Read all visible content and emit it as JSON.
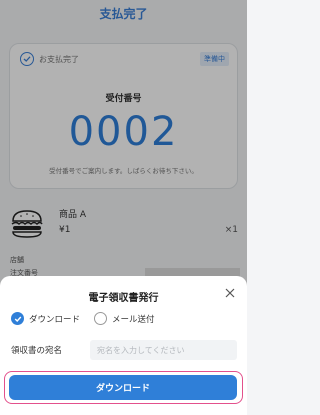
{
  "header": {
    "title": "支払完了"
  },
  "order_card": {
    "status": "お支払完了",
    "badge": "準備中",
    "reception_label": "受付番号",
    "reception_number": "0002",
    "reception_note": "受付番号でご案内します。しばらくお待ち下さい。"
  },
  "item": {
    "name": "商品 A",
    "price": "¥1",
    "quantity": "×1"
  },
  "details": {
    "store_label": "店舗",
    "order_no_label": "注文番号"
  },
  "receipt_sheet": {
    "title": "電子領収書発行",
    "options": [
      {
        "label": "ダウンロード",
        "selected": true
      },
      {
        "label": "メール送付",
        "selected": false
      }
    ],
    "recipient_label": "領収書の宛名",
    "recipient_placeholder": "宛名を入力してください",
    "download_button": "ダウンロード"
  },
  "colors": {
    "accent": "#2f7fd8",
    "highlight": "#e3508c"
  },
  "icons": {
    "status": "check-circle-icon",
    "close": "close-icon",
    "item": "hamburger-icon"
  }
}
